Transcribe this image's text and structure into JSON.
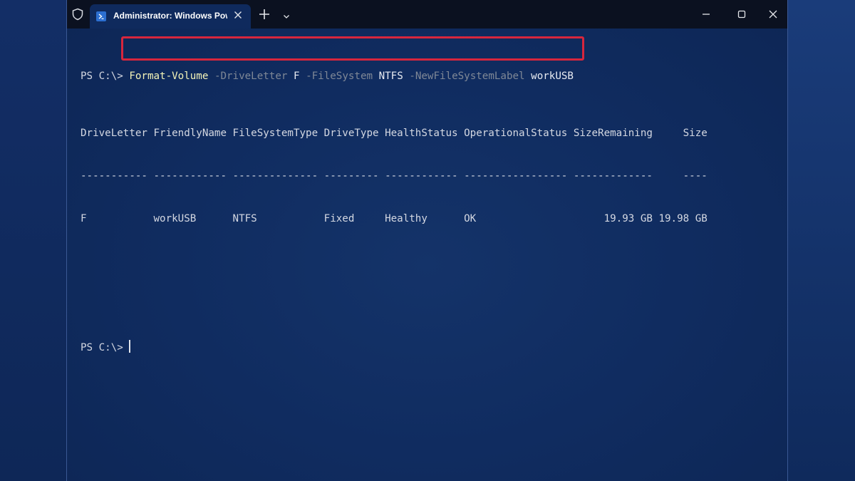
{
  "window": {
    "tab_title": "Administrator: Windows Powe",
    "icons": {
      "shield": "shield-icon",
      "tab": "powershell-icon",
      "close_tab": "close-icon",
      "new_tab": "plus-icon",
      "dropdown": "chevron-down-icon",
      "minimize": "minimize-icon",
      "maximize": "maximize-icon",
      "close": "close-icon"
    }
  },
  "terminal": {
    "prompt": "PS C:\\>",
    "command": {
      "cmdlet": "Format-Volume",
      "p1": "-DriveLetter",
      "v1": "F",
      "p2": "-FileSystem",
      "v2": "NTFS",
      "p3": "-NewFileSystemLabel",
      "v3": "workUSB"
    },
    "table": {
      "header": "DriveLetter FriendlyName FileSystemType DriveType HealthStatus OperationalStatus SizeRemaining     Size",
      "divider": "----------- ------------ -------------- --------- ------------ ----------------- -------------     ----",
      "row": "F           workUSB      NTFS           Fixed     Healthy      OK                     19.93 GB 19.98 GB"
    },
    "second_prompt": "PS C:\\>"
  },
  "colors": {
    "terminal_bg": "#102c60",
    "titlebar_bg": "#0b1120",
    "cmdlet": "#f4f4b8",
    "parameter": "#7f8896",
    "highlight_border": "#d7263d"
  }
}
